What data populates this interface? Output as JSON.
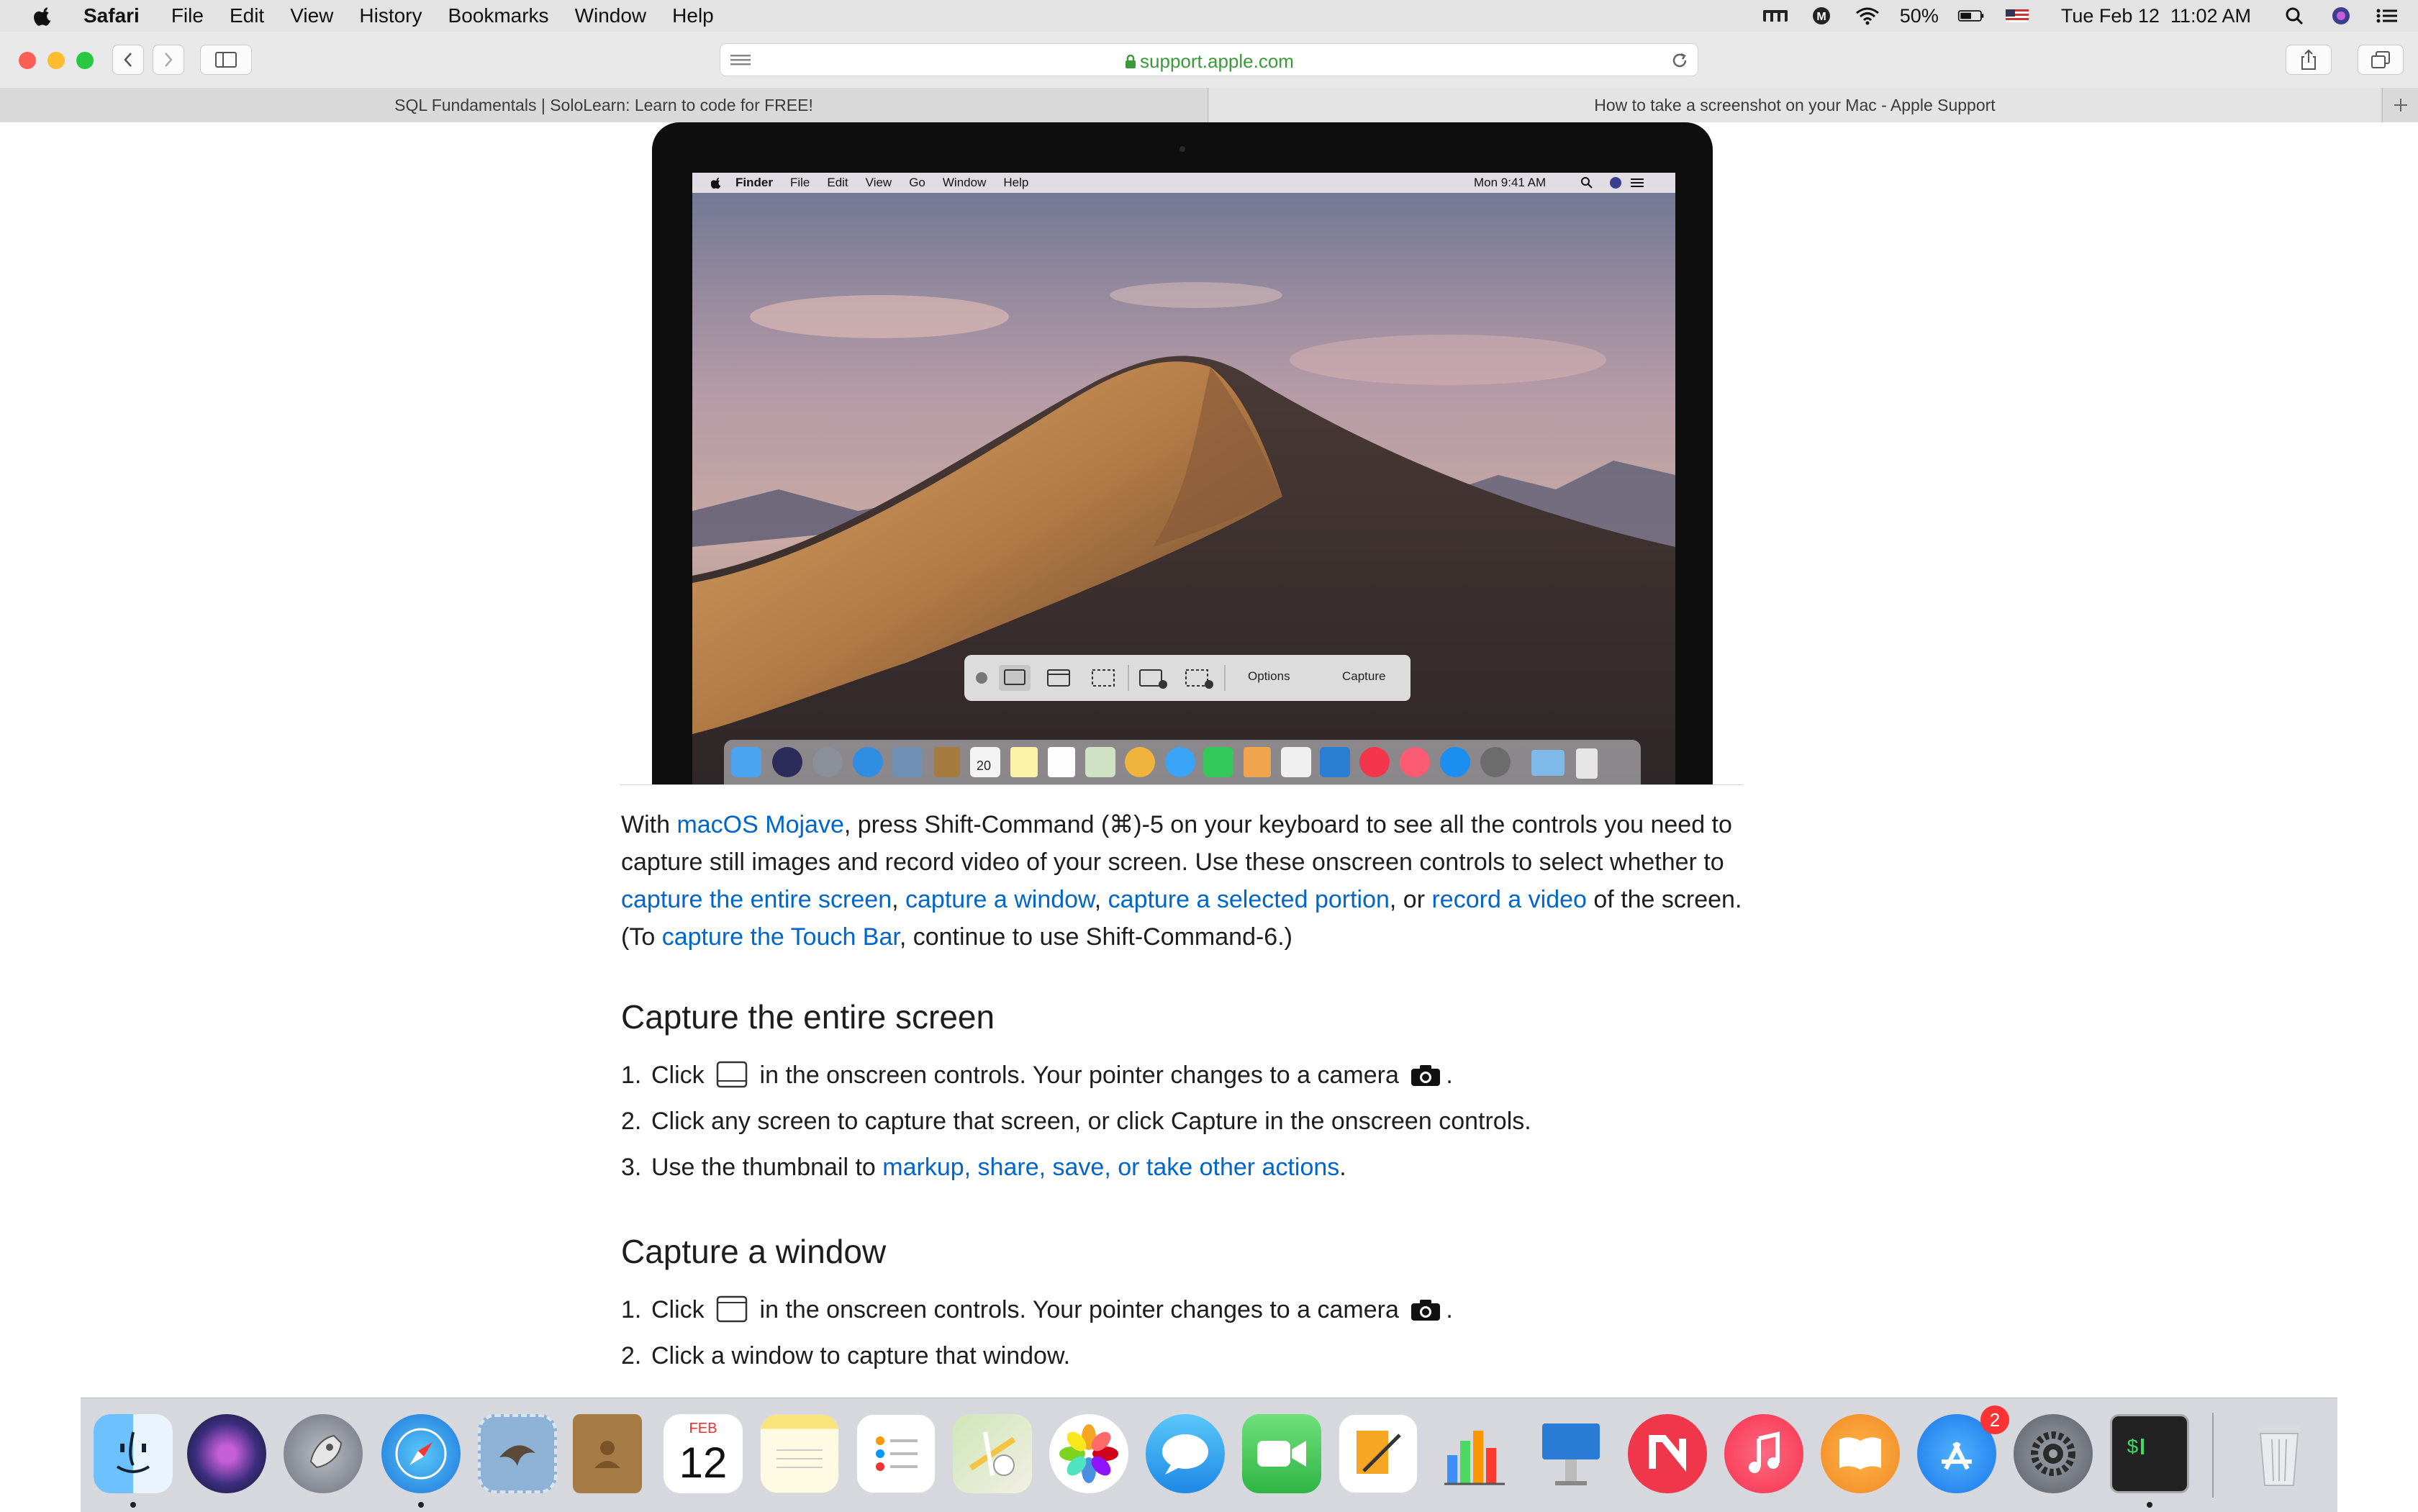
{
  "menubar": {
    "app": "Safari",
    "items": [
      "File",
      "Edit",
      "View",
      "History",
      "Bookmarks",
      "Window",
      "Help"
    ],
    "battery": "50%",
    "datetime": "Tue Feb 12  11:02 AM"
  },
  "toolbar": {
    "url": "support.apple.com"
  },
  "tabs": [
    {
      "title": "SQL Fundamentals | SoloLearn: Learn to code for FREE!"
    },
    {
      "title": "How to take a screenshot on your Mac - Apple Support"
    }
  ],
  "mock": {
    "app": "Finder",
    "menu": [
      "File",
      "Edit",
      "View",
      "Go",
      "Window",
      "Help"
    ],
    "time": "Mon 9:41 AM",
    "options": "Options",
    "capture": "Capture",
    "dock_date": "20"
  },
  "article": {
    "p1": [
      "With ",
      "macOS Mojave",
      ", press Shift-Command (⌘)-5 on your keyboard to see all the controls you need to capture still images and record video of your screen. Use these onscreen controls to select whether to ",
      "capture the entire screen",
      ", ",
      "capture a window",
      ", ",
      "capture a selected portion",
      ", or ",
      "record a video",
      " of the screen. (To ",
      "capture the Touch Bar",
      ", continue to use Shift-Command-6.)"
    ],
    "h_entire": "Capture the entire screen",
    "entire_steps": [
      {
        "num": "1.",
        "before": "Click ",
        "after": " in the onscreen controls. Your pointer changes to a camera ",
        "end": "."
      },
      {
        "num": "2.",
        "text": "Click any screen to capture that screen, or click Capture in the onscreen controls."
      },
      {
        "num": "3.",
        "before": "Use the thumbnail to ",
        "link": "markup, share, save, or take other actions",
        "end": "."
      }
    ],
    "h_window": "Capture a window",
    "window_steps": [
      {
        "num": "1.",
        "before": "Click ",
        "after": " in the onscreen controls. Your pointer changes to a camera ",
        "end": "."
      },
      {
        "num": "2.",
        "text": "Click a window to capture that window."
      }
    ]
  },
  "dock": {
    "calendar_month": "FEB",
    "calendar_day": "12",
    "appstore_badge": "2"
  },
  "colors": {
    "link": "#0066cc",
    "url_green": "#3a9a3a"
  }
}
